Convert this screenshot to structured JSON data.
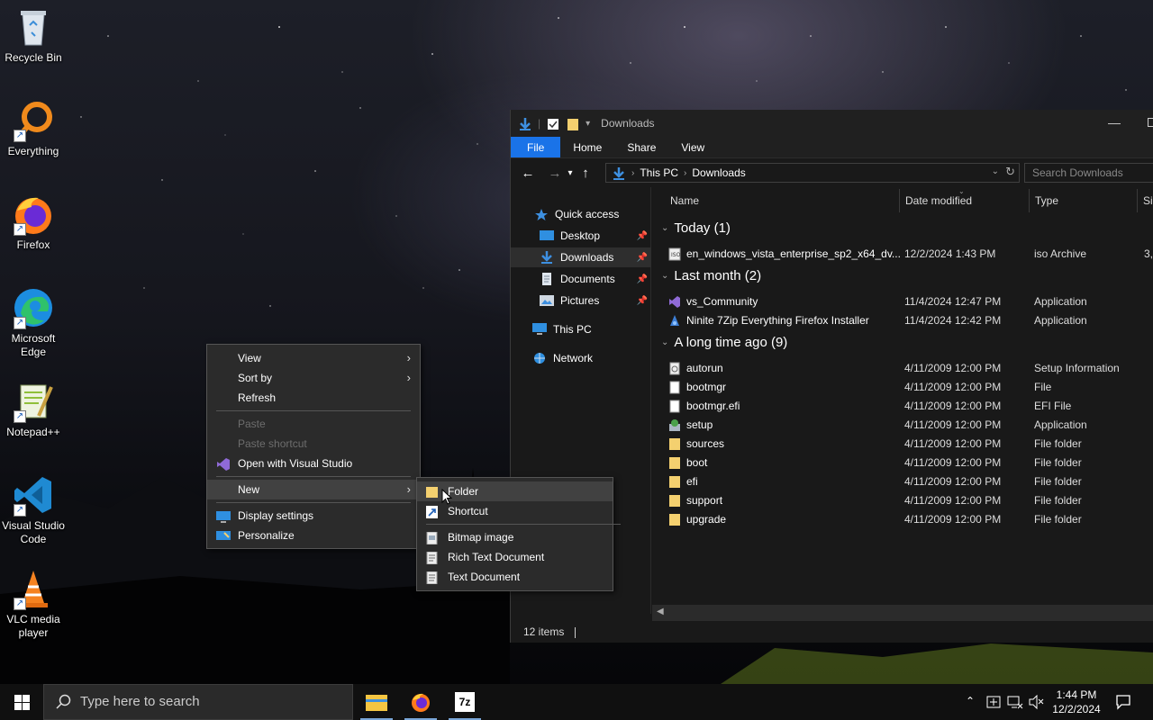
{
  "desktop": {
    "icons": [
      {
        "label": "Recycle Bin"
      },
      {
        "label": "Everything"
      },
      {
        "label": "Firefox"
      },
      {
        "label": "Microsoft Edge"
      },
      {
        "label": "Notepad++"
      },
      {
        "label": "Visual Studio Code"
      },
      {
        "label": "VLC media player"
      }
    ]
  },
  "explorer": {
    "title": "Downloads",
    "ribbon_tabs": [
      "File",
      "Home",
      "Share",
      "View"
    ],
    "breadcrumb": [
      "This PC",
      "Downloads"
    ],
    "search_placeholder": "Search Downloads",
    "nav": {
      "quick_access": "Quick access",
      "desktop": "Desktop",
      "downloads": "Downloads",
      "documents": "Documents",
      "pictures": "Pictures",
      "this_pc": "This PC",
      "network": "Network"
    },
    "columns": {
      "name": "Name",
      "date": "Date modified",
      "type": "Type",
      "size": "Siz"
    },
    "groups": {
      "today": "Today (1)",
      "last_month": "Last month (2)",
      "long_ago": "A long time ago (9)"
    },
    "files": [
      {
        "name": "en_windows_vista_enterprise_sp2_x64_dv...",
        "date": "12/2/2024 1:43 PM",
        "type": "iso Archive",
        "size": "3,"
      },
      {
        "name": "vs_Community",
        "date": "11/4/2024 12:47 PM",
        "type": "Application",
        "size": ""
      },
      {
        "name": "Ninite 7Zip Everything Firefox Installer",
        "date": "11/4/2024 12:42 PM",
        "type": "Application",
        "size": ""
      },
      {
        "name": "autorun",
        "date": "4/11/2009 12:00 PM",
        "type": "Setup Information",
        "size": ""
      },
      {
        "name": "bootmgr",
        "date": "4/11/2009 12:00 PM",
        "type": "File",
        "size": ""
      },
      {
        "name": "bootmgr.efi",
        "date": "4/11/2009 12:00 PM",
        "type": "EFI File",
        "size": ""
      },
      {
        "name": "setup",
        "date": "4/11/2009 12:00 PM",
        "type": "Application",
        "size": ""
      },
      {
        "name": "sources",
        "date": "4/11/2009 12:00 PM",
        "type": "File folder",
        "size": ""
      },
      {
        "name": "boot",
        "date": "4/11/2009 12:00 PM",
        "type": "File folder",
        "size": ""
      },
      {
        "name": "efi",
        "date": "4/11/2009 12:00 PM",
        "type": "File folder",
        "size": ""
      },
      {
        "name": "support",
        "date": "4/11/2009 12:00 PM",
        "type": "File folder",
        "size": ""
      },
      {
        "name": "upgrade",
        "date": "4/11/2009 12:00 PM",
        "type": "File folder",
        "size": ""
      }
    ],
    "status": "12 items"
  },
  "context_menu": {
    "view": "View",
    "sort_by": "Sort by",
    "refresh": "Refresh",
    "paste": "Paste",
    "paste_shortcut": "Paste shortcut",
    "open_vs": "Open with Visual Studio",
    "new": "New",
    "display_settings": "Display settings",
    "personalize": "Personalize"
  },
  "new_submenu": {
    "folder": "Folder",
    "shortcut": "Shortcut",
    "bitmap": "Bitmap image",
    "rtf": "Rich Text Document",
    "txt": "Text Document"
  },
  "taskbar": {
    "search_placeholder": "Type here to search",
    "time": "1:44 PM",
    "date": "12/2/2024",
    "sevenzip_label": "7z"
  },
  "colors": {
    "accent": "#1a73e8",
    "folder": "#f4d06f",
    "menu_bg": "#2b2b2b"
  }
}
